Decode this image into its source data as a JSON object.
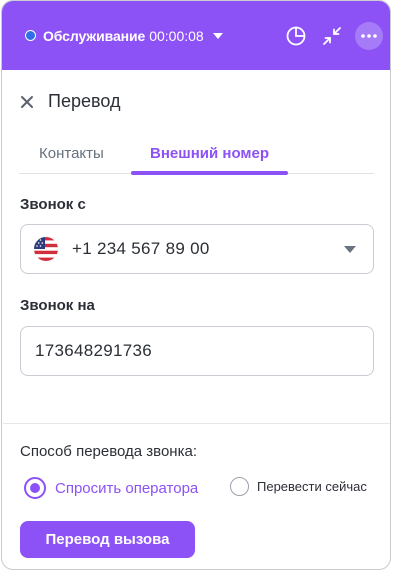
{
  "header": {
    "status_label": "Обслуживание",
    "timer": "00:00:08",
    "status_color": "#2f6fe6",
    "icons": [
      "pie-chart-icon",
      "collapse-icon",
      "more-icon"
    ]
  },
  "dialog": {
    "title": "Перевод",
    "close_icon": "close-icon"
  },
  "tabs": [
    {
      "label": "Контакты",
      "active": false
    },
    {
      "label": "Внешний номер",
      "active": true
    }
  ],
  "form": {
    "from_label": "Звонок с",
    "from_value": "+1 234 567 89 00",
    "from_flag": "us-flag-icon",
    "to_label": "Звонок на",
    "to_value": "173648291736"
  },
  "transfer_method": {
    "label": "Способ перевода звонка:",
    "options": [
      {
        "label": "Спросить оператора",
        "selected": true
      },
      {
        "label": "Перевести сейчас",
        "selected": false
      }
    ]
  },
  "submit_label": "Перевод вызова",
  "colors": {
    "accent": "#8c52f6",
    "text": "#2b2f36",
    "muted": "#66707c"
  }
}
